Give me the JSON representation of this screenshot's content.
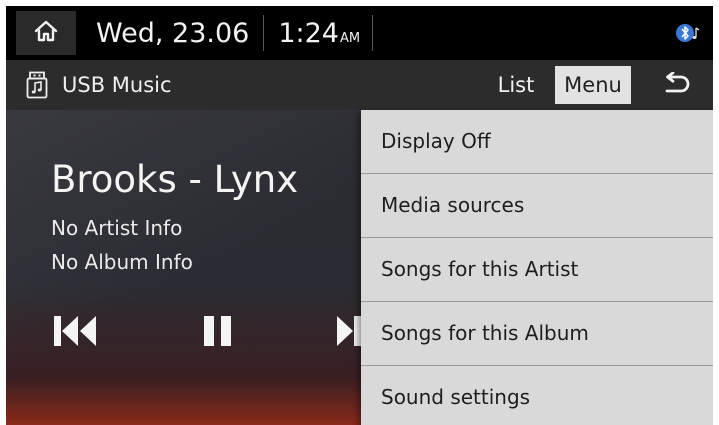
{
  "status_bar": {
    "date": "Wed, 23.06",
    "time": "1:24",
    "ampm": "AM",
    "icons": [
      "home-icon",
      "bluetooth-music-icon"
    ]
  },
  "title_bar": {
    "title": "USB Music",
    "list_label": "List",
    "menu_label": "Menu",
    "icons": [
      "usb-music-icon",
      "back-icon"
    ]
  },
  "track": {
    "title": "Brooks - Lynx",
    "artist": "No Artist Info",
    "album": "No Album Info"
  },
  "controls": [
    "previous-icon",
    "pause-icon",
    "next-icon"
  ],
  "menu": {
    "items": [
      {
        "label": "Display Off"
      },
      {
        "label": "Media sources"
      },
      {
        "label": "Songs for this Artist"
      },
      {
        "label": "Songs for this Album"
      },
      {
        "label": "Sound settings"
      }
    ]
  },
  "colors": {
    "background": "#2a2b31",
    "menu_bg": "#d9d9d9",
    "selected_button_bg": "#e2e2e2",
    "bluetooth_blue": "#3a78d6"
  }
}
